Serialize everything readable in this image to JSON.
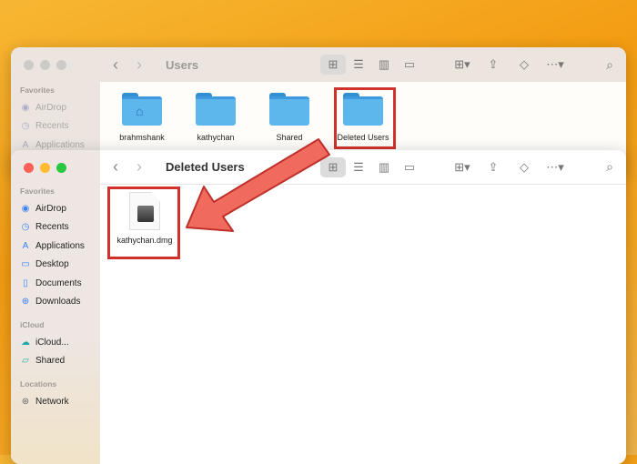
{
  "back_window": {
    "title": "Users",
    "sidebar": {
      "section": "Favorites",
      "items": [
        {
          "label": "AirDrop",
          "icon": "airdrop-icon"
        },
        {
          "label": "Recents",
          "icon": "clock-icon"
        },
        {
          "label": "Applications",
          "icon": "applications-icon"
        }
      ]
    },
    "folders": [
      {
        "label": "brahmshank",
        "icon": "home-folder-icon"
      },
      {
        "label": "kathychan",
        "icon": "folder-icon"
      },
      {
        "label": "Shared",
        "icon": "folder-icon"
      },
      {
        "label": "Deleted Users",
        "icon": "folder-icon"
      }
    ]
  },
  "front_window": {
    "title": "Deleted Users",
    "sidebar": {
      "favorites_label": "Favorites",
      "favorites": [
        {
          "label": "AirDrop"
        },
        {
          "label": "Recents"
        },
        {
          "label": "Applications"
        },
        {
          "label": "Desktop"
        },
        {
          "label": "Documents"
        },
        {
          "label": "Downloads"
        }
      ],
      "icloud_label": "iCloud",
      "icloud": [
        {
          "label": "iCloud..."
        },
        {
          "label": "Shared"
        }
      ],
      "locations_label": "Locations",
      "locations": [
        {
          "label": "Network"
        }
      ]
    },
    "files": [
      {
        "label": "kathychan.dmg",
        "icon": "disk-image-icon"
      }
    ]
  },
  "colors": {
    "highlight": "#d0312d",
    "arrow_fill": "#f06a5e",
    "arrow_stroke": "#c0302a"
  }
}
